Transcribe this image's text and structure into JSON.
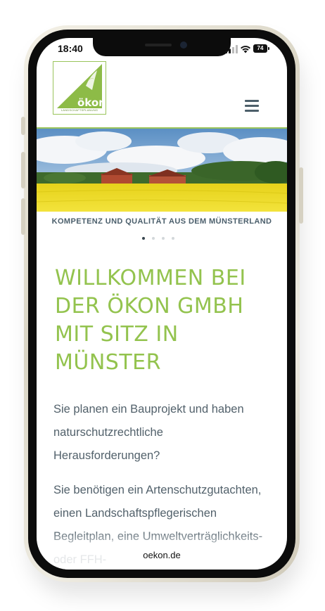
{
  "status_bar": {
    "time": "18:40",
    "battery": "74",
    "icons": [
      "signal-icon",
      "wifi-icon",
      "battery-icon"
    ]
  },
  "header": {
    "logo_text": "ökon",
    "logo_subtitle": "LANDSCHAFTSPLANUNG",
    "menu_icon": "hamburger-menu-icon"
  },
  "hero": {
    "caption": "KOMPETENZ UND QUALITÄT AUS DEM MÜNSTERLAND",
    "slides_count": 4,
    "active_slide": 1
  },
  "main": {
    "heading": "WILLKOMMEN BEI DER ÖKON GMBH MIT SITZ IN MÜNSTER",
    "paragraph_1": "Sie planen ein Bauprojekt und haben naturschutzrechtliche Herausforderungen?",
    "paragraph_2": "Sie benötigen ein Artenschutzgutachten, einen Landschaftspflegerischen Begleitplan, eine Umweltverträglichkeits- oder FFH-"
  },
  "browser": {
    "url": "oekon.de"
  },
  "colors": {
    "brand_green": "#93c34e",
    "text_slate": "#52616b",
    "rule_green": "#9ac45b"
  }
}
